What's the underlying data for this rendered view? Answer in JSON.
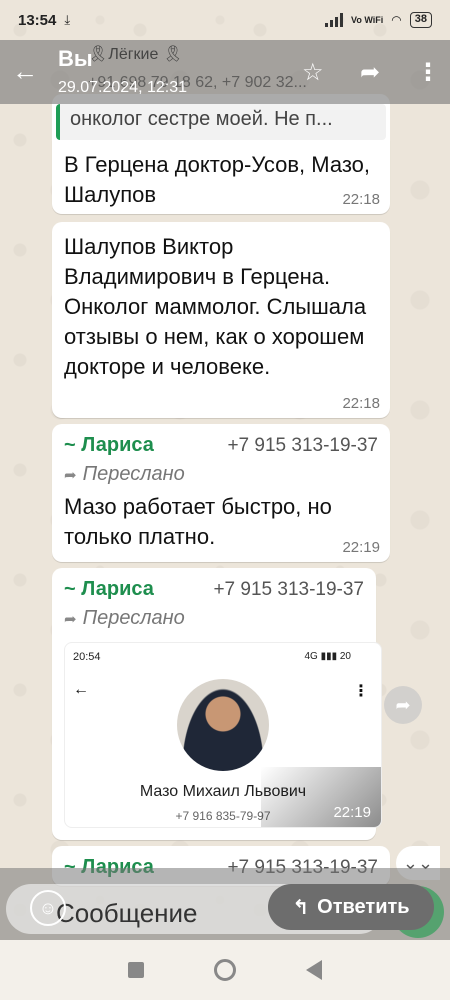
{
  "status_bar": {
    "time": "13:54",
    "download_indicator": "⤓",
    "network": "Vo WiFi",
    "battery": "38"
  },
  "header": {
    "title": "Вы",
    "subtitle": "29.07.2024, 12:31",
    "underlying_sender": "🎗Лёгкие 🎗",
    "underlying_phones": "+91 698 79 18 62, +7 902 32..."
  },
  "messages": [
    {
      "quote": "онколог  сестре моей. Не п...",
      "text": "В Герцена доктор-Усов, Мазо, Шалупов",
      "time": "22:18"
    },
    {
      "text": "Шалупов Виктор Владимирович в Герцена. Онколог маммолог. Слышала отзывы о нем, как о хорошем докторе и человеке.",
      "time": "22:18"
    },
    {
      "sender": "~ Лариса",
      "phone": "+7 915 313-19-37",
      "forwarded": "Переслано",
      "text": "Мазо работает быстро, но только платно.",
      "time": "22:19"
    },
    {
      "sender": "~ Лариса",
      "phone": "+7 915 313-19-37",
      "forwarded": "Переслано",
      "image": {
        "status_time": "20:54",
        "status_right": "4G ▮▮▮ 20",
        "name": "Мазо Михаил Львович",
        "phone": "+7 916 835-79-97"
      },
      "time": "22:19"
    },
    {
      "sender": "~ Лариса",
      "phone": "+7 915 313-19-37"
    }
  ],
  "input": {
    "placeholder": "Сообщение",
    "reply_label": "Ответить"
  },
  "colors": {
    "accent_green": "#1e8e4e",
    "selection_overlay": "#787878"
  }
}
